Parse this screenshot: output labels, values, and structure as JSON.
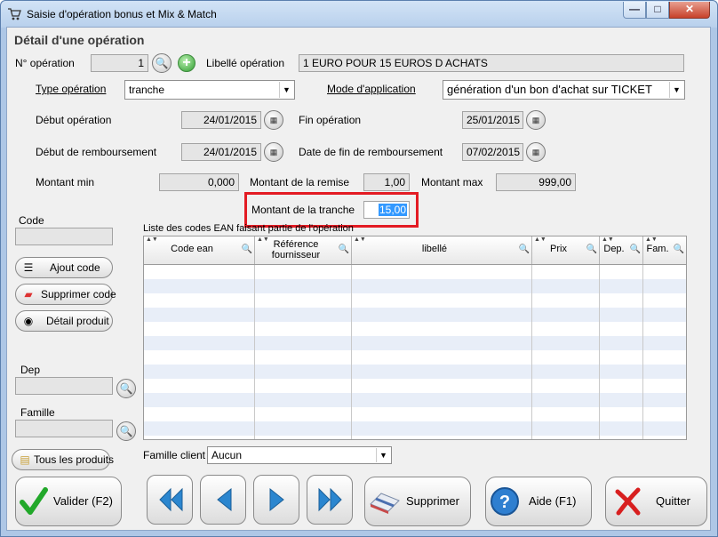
{
  "window": {
    "title": "Saisie d'opération bonus et Mix & Match",
    "minimize": "—",
    "maximize": "□",
    "close": "✕"
  },
  "section_title": "Détail d'une opération",
  "operation": {
    "numero_label": "N° opération",
    "numero_value": "1",
    "libelle_label": "Libellé opération",
    "libelle_value": "1 EURO POUR 15 EUROS D ACHATS",
    "type_label": "Type opération",
    "type_value": "tranche",
    "mode_label": "Mode d'application",
    "mode_value": "génération d'un bon d'achat sur TICKET",
    "debut_label": "Début opération",
    "debut_value": "24/01/2015",
    "fin_label": "Fin opération",
    "fin_value": "25/01/2015",
    "debut_remb_label": "Début de remboursement",
    "debut_remb_value": "24/01/2015",
    "fin_remb_label": "Date de fin de remboursement",
    "fin_remb_value": "07/02/2015",
    "montant_min_label": "Montant min",
    "montant_min_value": "0,000",
    "montant_remise_label": "Montant de la remise",
    "montant_remise_value": "1,00",
    "montant_max_label": "Montant max",
    "montant_max_value": "999,00",
    "montant_tranche_label": "Montant de la tranche",
    "montant_tranche_value": "15,00"
  },
  "left_panel": {
    "code_label": "Code",
    "ajout_code": "Ajout code",
    "supprimer_code": "Supprimer code",
    "detail_produit": "Détail produit",
    "dep_label": "Dep",
    "famille_label": "Famille",
    "tous_produits": "Tous les produits"
  },
  "grid": {
    "caption": "Liste des codes EAN faisant partie de l'opération",
    "columns": [
      "Code ean",
      "Référence fournisseur",
      "libellé",
      "Prix",
      "Dep.",
      "Fam."
    ]
  },
  "famille_client": {
    "label": "Famille client",
    "value": "Aucun"
  },
  "buttons": {
    "valider": "Valider (F2)",
    "supprimer": "Supprimer",
    "aide": "Aide (F1)",
    "quitter": "Quitter"
  },
  "colors": {
    "highlight": "#e31b23",
    "accent_blue": "#1f78c8",
    "selection": "#3399ff"
  }
}
